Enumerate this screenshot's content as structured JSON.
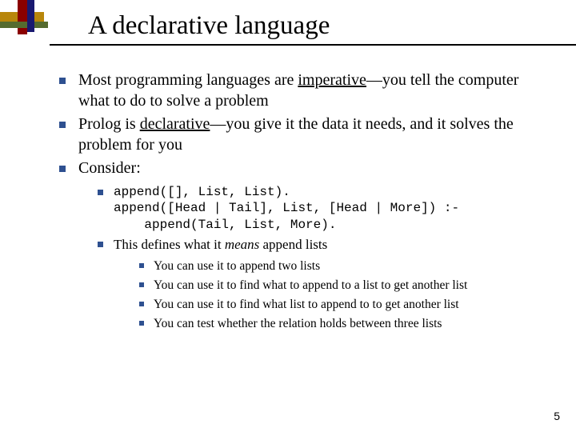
{
  "title": "A declarative language",
  "bullets": {
    "b1_pre": "Most programming languages are ",
    "b1_u": "imperative",
    "b1_post": "—you tell the computer what to do to solve a problem",
    "b2_pre": "Prolog is ",
    "b2_u": "declarative",
    "b2_post": "—you give it the data it needs, and it solves the problem for you",
    "b3": "Consider:"
  },
  "code": "append([], List, List).\nappend([Head | Tail], List, [Head | More]) :-\n    append(Tail, List, More).",
  "sub": {
    "s2_pre": "This defines what it ",
    "s2_i": "means",
    "s2_post": " append lists"
  },
  "uses": {
    "u1": "You can use it to append two lists",
    "u2": "You can use it to find what to append to a list to get another list",
    "u3": "You can use it to find what list to append to to get another list",
    "u4": "You can test whether the relation holds between three lists"
  },
  "page": "5"
}
